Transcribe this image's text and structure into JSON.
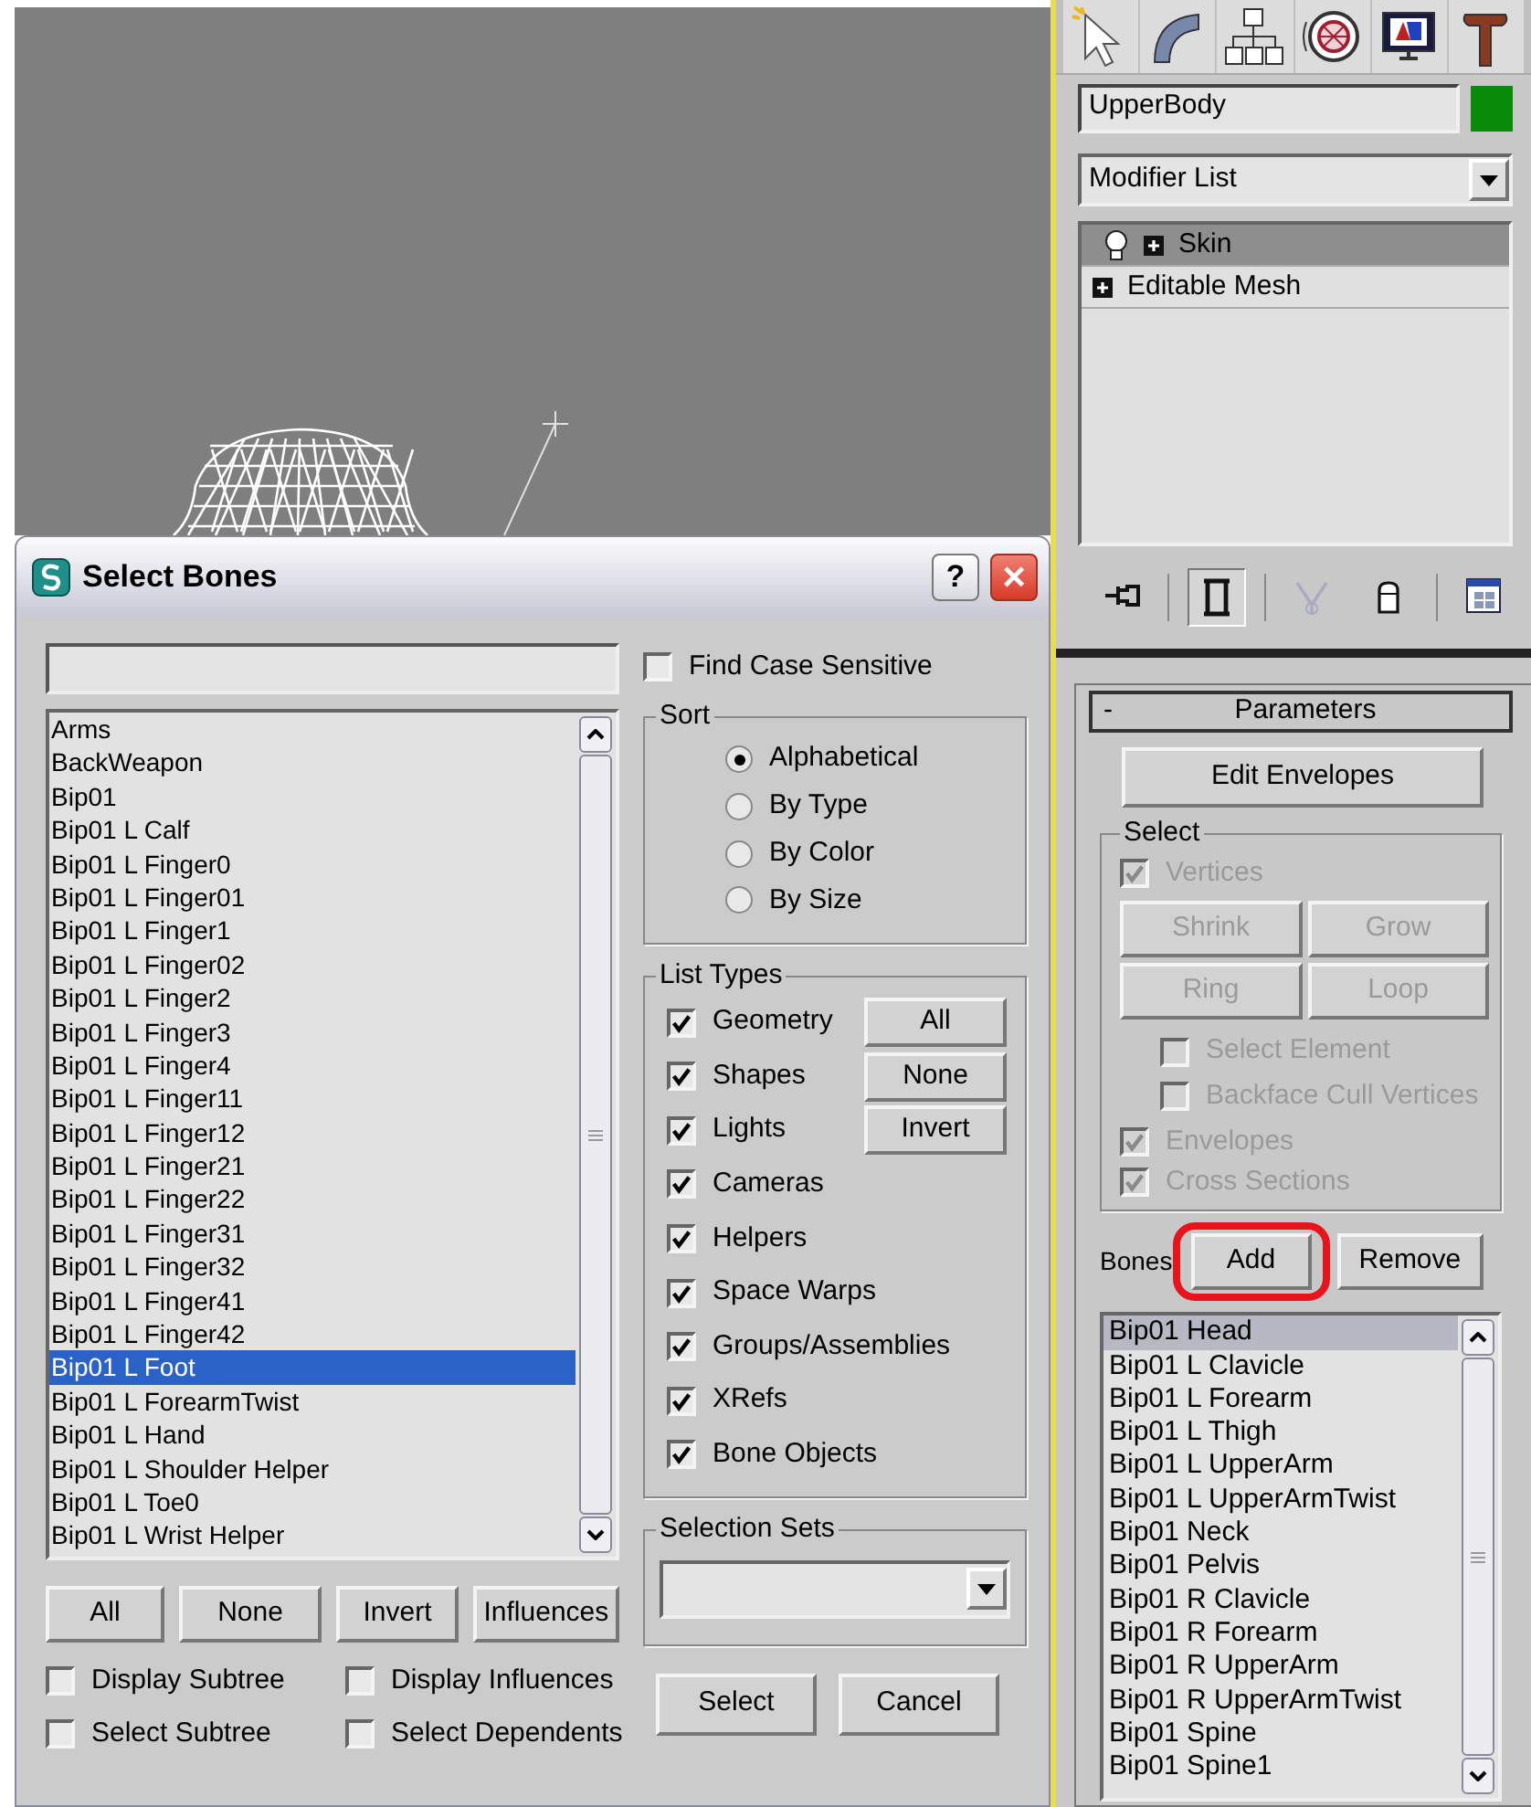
{
  "dialog": {
    "title": "Select Bones",
    "help_button": "?",
    "close_button": "×",
    "objects": [
      {
        "label": "Arms",
        "selected": false
      },
      {
        "label": "BackWeapon",
        "selected": false
      },
      {
        "label": "Bip01",
        "selected": false
      },
      {
        "label": "Bip01 L Calf",
        "selected": false
      },
      {
        "label": "Bip01 L Finger0",
        "selected": false
      },
      {
        "label": "Bip01 L Finger01",
        "selected": false
      },
      {
        "label": "Bip01 L Finger1",
        "selected": false
      },
      {
        "label": "Bip01 L Finger02",
        "selected": false
      },
      {
        "label": "Bip01 L Finger2",
        "selected": false
      },
      {
        "label": "Bip01 L Finger3",
        "selected": false
      },
      {
        "label": "Bip01 L Finger4",
        "selected": false
      },
      {
        "label": "Bip01 L Finger11",
        "selected": false
      },
      {
        "label": "Bip01 L Finger12",
        "selected": false
      },
      {
        "label": "Bip01 L Finger21",
        "selected": false
      },
      {
        "label": "Bip01 L Finger22",
        "selected": false
      },
      {
        "label": "Bip01 L Finger31",
        "selected": false
      },
      {
        "label": "Bip01 L Finger32",
        "selected": false
      },
      {
        "label": "Bip01 L Finger41",
        "selected": false
      },
      {
        "label": "Bip01 L Finger42",
        "selected": false
      },
      {
        "label": "Bip01 L Foot",
        "selected": true
      },
      {
        "label": "Bip01 L ForearmTwist",
        "selected": false
      },
      {
        "label": "Bip01 L Hand",
        "selected": false
      },
      {
        "label": "Bip01 L Shoulder Helper",
        "selected": false
      },
      {
        "label": "Bip01 L Toe0",
        "selected": false
      },
      {
        "label": "Bip01 L Wrist Helper",
        "selected": false
      }
    ],
    "list_buttons": [
      {
        "label": "All"
      },
      {
        "label": "None"
      },
      {
        "label": "Invert"
      },
      {
        "label": "Influences"
      }
    ],
    "options": [
      {
        "label": "Display Subtree",
        "checked": false
      },
      {
        "label": "Display Influences",
        "checked": false
      },
      {
        "label": "Select Subtree",
        "checked": false
      },
      {
        "label": "Select Dependents",
        "checked": false
      }
    ],
    "find_case_sensitive": {
      "label": "Find Case Sensitive",
      "checked": false
    },
    "sort": {
      "title": "Sort",
      "options": [
        {
          "label": "Alphabetical",
          "selected": true
        },
        {
          "label": "By Type",
          "selected": false
        },
        {
          "label": "By Color",
          "selected": false
        },
        {
          "label": "By Size",
          "selected": false
        }
      ]
    },
    "list_types": {
      "title": "List Types",
      "types": [
        {
          "label": "Geometry",
          "checked": true
        },
        {
          "label": "Shapes",
          "checked": true
        },
        {
          "label": "Lights",
          "checked": true
        },
        {
          "label": "Cameras",
          "checked": true
        },
        {
          "label": "Helpers",
          "checked": true
        },
        {
          "label": "Space Warps",
          "checked": true
        },
        {
          "label": "Groups/Assemblies",
          "checked": true
        },
        {
          "label": "XRefs",
          "checked": true
        },
        {
          "label": "Bone Objects",
          "checked": true
        }
      ],
      "buttons": [
        {
          "label": "All"
        },
        {
          "label": "None"
        },
        {
          "label": "Invert"
        }
      ]
    },
    "selection_sets": {
      "title": "Selection Sets"
    },
    "actions": [
      {
        "label": "Select"
      },
      {
        "label": "Cancel"
      }
    ]
  },
  "command_panel": {
    "object": {
      "name": "UpperBody",
      "color": "#0a8c0a"
    },
    "modifier_list": "Modifier List",
    "stack": [
      {
        "label": "Skin",
        "kind": "modifier",
        "selected": true
      },
      {
        "label": "Editable Mesh",
        "kind": "base",
        "selected": false
      }
    ],
    "stack_tools": [
      {
        "pressed": false
      },
      {
        "pressed": true
      },
      {
        "pressed": false
      },
      {
        "pressed": false
      },
      {
        "pressed": false
      }
    ],
    "rollout": {
      "toggle": "-",
      "title": "Parameters",
      "edit_envelopes": "Edit Envelopes",
      "select": {
        "title": "Select",
        "vertices": {
          "label": "Vertices",
          "checked": true,
          "disabled": true
        },
        "buttons": [
          {
            "label": "Shrink",
            "disabled": true
          },
          {
            "label": "Grow",
            "disabled": true
          },
          {
            "label": "Ring",
            "disabled": true
          },
          {
            "label": "Loop",
            "disabled": true
          }
        ],
        "sub_options": [
          {
            "label": "Select Element",
            "checked": false,
            "disabled": true
          },
          {
            "label": "Backface Cull Vertices",
            "checked": false,
            "disabled": true
          }
        ],
        "options": [
          {
            "label": "Envelopes",
            "checked": true,
            "disabled": true
          },
          {
            "label": "Cross Sections",
            "checked": true,
            "disabled": true
          }
        ]
      },
      "bones_label": "Bones",
      "bone_buttons": [
        {
          "label": "Add",
          "highlighted": true
        },
        {
          "label": "Remove",
          "highlighted": false
        }
      ],
      "bones": [
        {
          "label": "Bip01 Head",
          "selected": true
        },
        {
          "label": "Bip01 L Clavicle",
          "selected": false
        },
        {
          "label": "Bip01 L Forearm",
          "selected": false
        },
        {
          "label": "Bip01 L Thigh",
          "selected": false
        },
        {
          "label": "Bip01 L UpperArm",
          "selected": false
        },
        {
          "label": "Bip01 L UpperArmTwist",
          "selected": false
        },
        {
          "label": "Bip01 Neck",
          "selected": false
        },
        {
          "label": "Bip01 Pelvis",
          "selected": false
        },
        {
          "label": "Bip01 R Clavicle",
          "selected": false
        },
        {
          "label": "Bip01 R Forearm",
          "selected": false
        },
        {
          "label": "Bip01 R UpperArm",
          "selected": false
        },
        {
          "label": "Bip01 R UpperArmTwist",
          "selected": false
        },
        {
          "label": "Bip01 Spine",
          "selected": false
        },
        {
          "label": "Bip01 Spine1",
          "selected": false
        }
      ]
    }
  }
}
